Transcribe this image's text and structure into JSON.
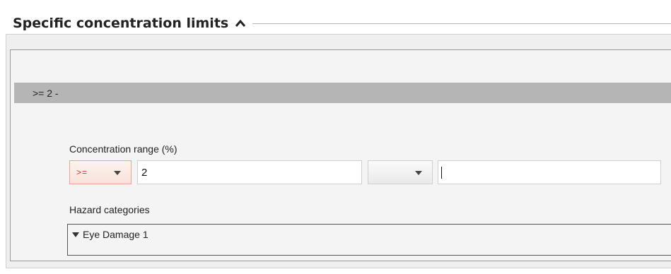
{
  "section": {
    "title": "Specific concentration limits",
    "collapse_icon": "chevron-up-icon"
  },
  "record": {
    "header_label": ">= 2 -"
  },
  "concentration_range": {
    "label": "Concentration range (%)",
    "lower_qualifier": ">=",
    "lower_value": "2",
    "upper_qualifier": "",
    "upper_value": ""
  },
  "hazard_categories": {
    "label": "Hazard categories",
    "items": [
      {
        "label": "Eye Damage 1",
        "icon": "triangle-down-icon"
      }
    ]
  },
  "colors": {
    "record_bar": "#b5b5b5",
    "qualifier_text": "#cc3333",
    "qualifier_border": "#e9a58f"
  }
}
